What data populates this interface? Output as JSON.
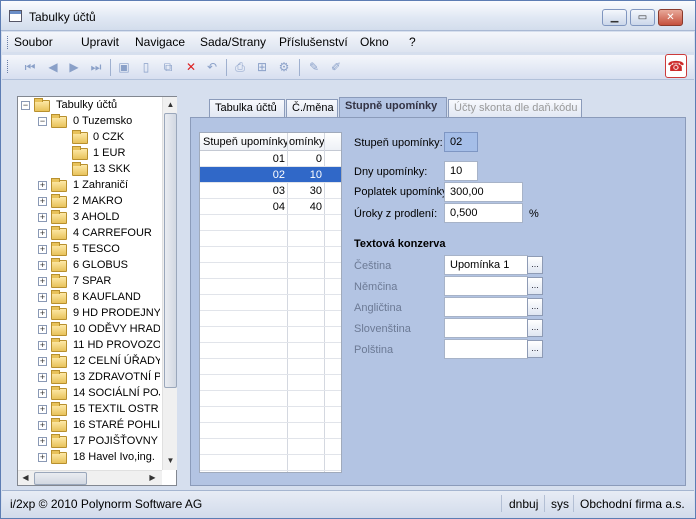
{
  "window": {
    "title": "Tabulky účtů"
  },
  "menu": [
    "Soubor",
    "Upravit",
    "Navigace",
    "Sada/Strany",
    "Příslušenství",
    "Okno",
    "?"
  ],
  "tree": {
    "root": "Tabulky účtů",
    "items": [
      {
        "label": "0 Tuzemsko"
      },
      {
        "label": "0 CZK"
      },
      {
        "label": "1 EUR"
      },
      {
        "label": "13 SKK"
      },
      {
        "label": "1 Zahraničí"
      },
      {
        "label": "2 MAKRO"
      },
      {
        "label": "3 AHOLD"
      },
      {
        "label": "4 CARREFOUR"
      },
      {
        "label": "5 TESCO"
      },
      {
        "label": "6 GLOBUS"
      },
      {
        "label": "7 SPAR"
      },
      {
        "label": "8 KAUFLAND"
      },
      {
        "label": "9 HD PRODEJNY"
      },
      {
        "label": "10 ODĚVY HRAD"
      },
      {
        "label": "11 HD PROVOZO"
      },
      {
        "label": "12 CELNÍ ÚŘADY"
      },
      {
        "label": "13 ZDRAVOTNÍ P"
      },
      {
        "label": "14 SOCIÁLNÍ POJ"
      },
      {
        "label": "15 TEXTIL OSTR"
      },
      {
        "label": "16 STARÉ POHLI"
      },
      {
        "label": "17 POJIŠŤOVNY"
      },
      {
        "label": "18 Havel Ivo,ing."
      }
    ]
  },
  "tabs": [
    {
      "label": "Tabulka účtů"
    },
    {
      "label": "Č./měna"
    },
    {
      "label": "Stupně upomínky"
    },
    {
      "label": "Účty skonta dle daň.kódu"
    }
  ],
  "grid": {
    "headers": [
      "Stupeň upomínky",
      "omínky"
    ],
    "rows": [
      {
        "stupen": "01",
        "dny": "0"
      },
      {
        "stupen": "02",
        "dny": "10"
      },
      {
        "stupen": "03",
        "dny": "30"
      },
      {
        "stupen": "04",
        "dny": "40"
      }
    ]
  },
  "form": {
    "stupen_label": "Stupeň upomínky:",
    "stupen_value": "02",
    "dny_label": "Dny upomínky:",
    "dny_value": "10",
    "poplatek_label": "Poplatek upomínky",
    "poplatek_value": "300,00",
    "uroky_label": "Úroky z prodlení:",
    "uroky_value": "0,500",
    "uroky_unit": "%",
    "section_title": "Textová konzerva",
    "lang_fields": [
      {
        "label": "Čeština",
        "value": "Upomínka 1"
      },
      {
        "label": "Němčina",
        "value": ""
      },
      {
        "label": "Angličtina",
        "value": ""
      },
      {
        "label": "Slovenština",
        "value": ""
      },
      {
        "label": "Polština",
        "value": ""
      }
    ],
    "pick_glyph": "..."
  },
  "status": {
    "copyright": "i/2xp © 2010 Polynorm Software AG",
    "user": "dnbuj",
    "db": "sys",
    "company": "Obchodní firma a.s."
  }
}
